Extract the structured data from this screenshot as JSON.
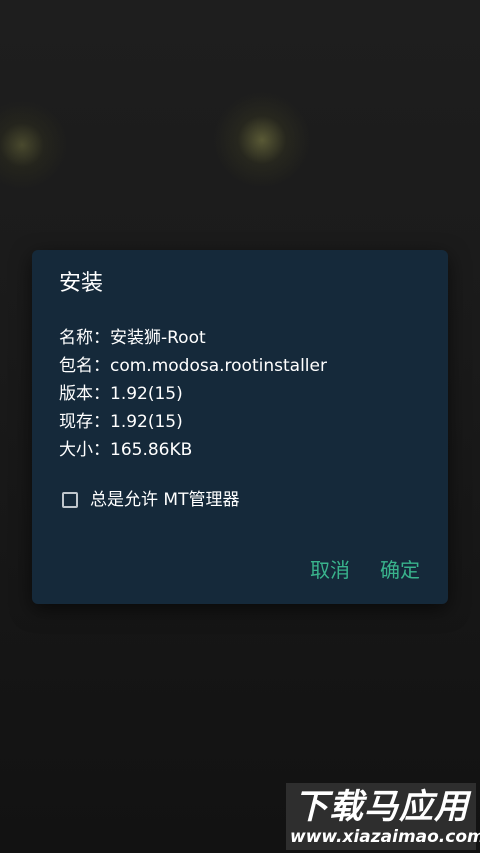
{
  "dialog": {
    "title": "安装",
    "info": [
      "名称：安装狮-Root",
      "包名：com.modosa.rootinstaller",
      "版本：1.92(15)",
      "现存：1.92(15)",
      "大小：165.86KB"
    ],
    "checkbox": {
      "label": "总是允许 MT管理器",
      "checked": false
    },
    "cancel_label": "取消",
    "confirm_label": "确定"
  },
  "watermark": {
    "title": "下载马应用",
    "url": "www.xiazaimao.com"
  },
  "colors": {
    "dialog_bg": "#15293a",
    "accent": "#39b38c",
    "text": "#ffffff"
  }
}
